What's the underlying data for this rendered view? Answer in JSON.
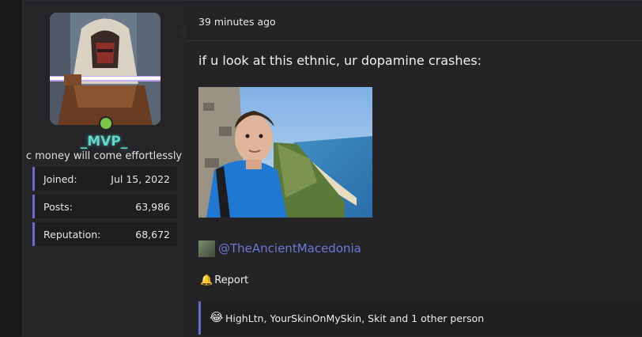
{
  "user": {
    "name": "_MVP_",
    "title": "c money will come effortlessly",
    "status": "online",
    "stats": [
      {
        "label": "Joined:",
        "value": "Jul 15, 2022"
      },
      {
        "label": "Posts:",
        "value": "63,986"
      },
      {
        "label": "Reputation:",
        "value": "68,672"
      }
    ]
  },
  "post": {
    "time": "39 minutes ago",
    "text": "if u look at this ethnic, ur dopamine crashes:",
    "mention": "@TheAncientMacedonia",
    "report_label": "Report",
    "reactions": {
      "emoji": "😂",
      "text": "HighLtn, YourSkinOnMySkin, Skit and 1 other person"
    }
  },
  "colors": {
    "accent": "#6a6ad0",
    "username": "#5fd9cc",
    "online": "#7bc44a",
    "link": "#6a78d6"
  }
}
